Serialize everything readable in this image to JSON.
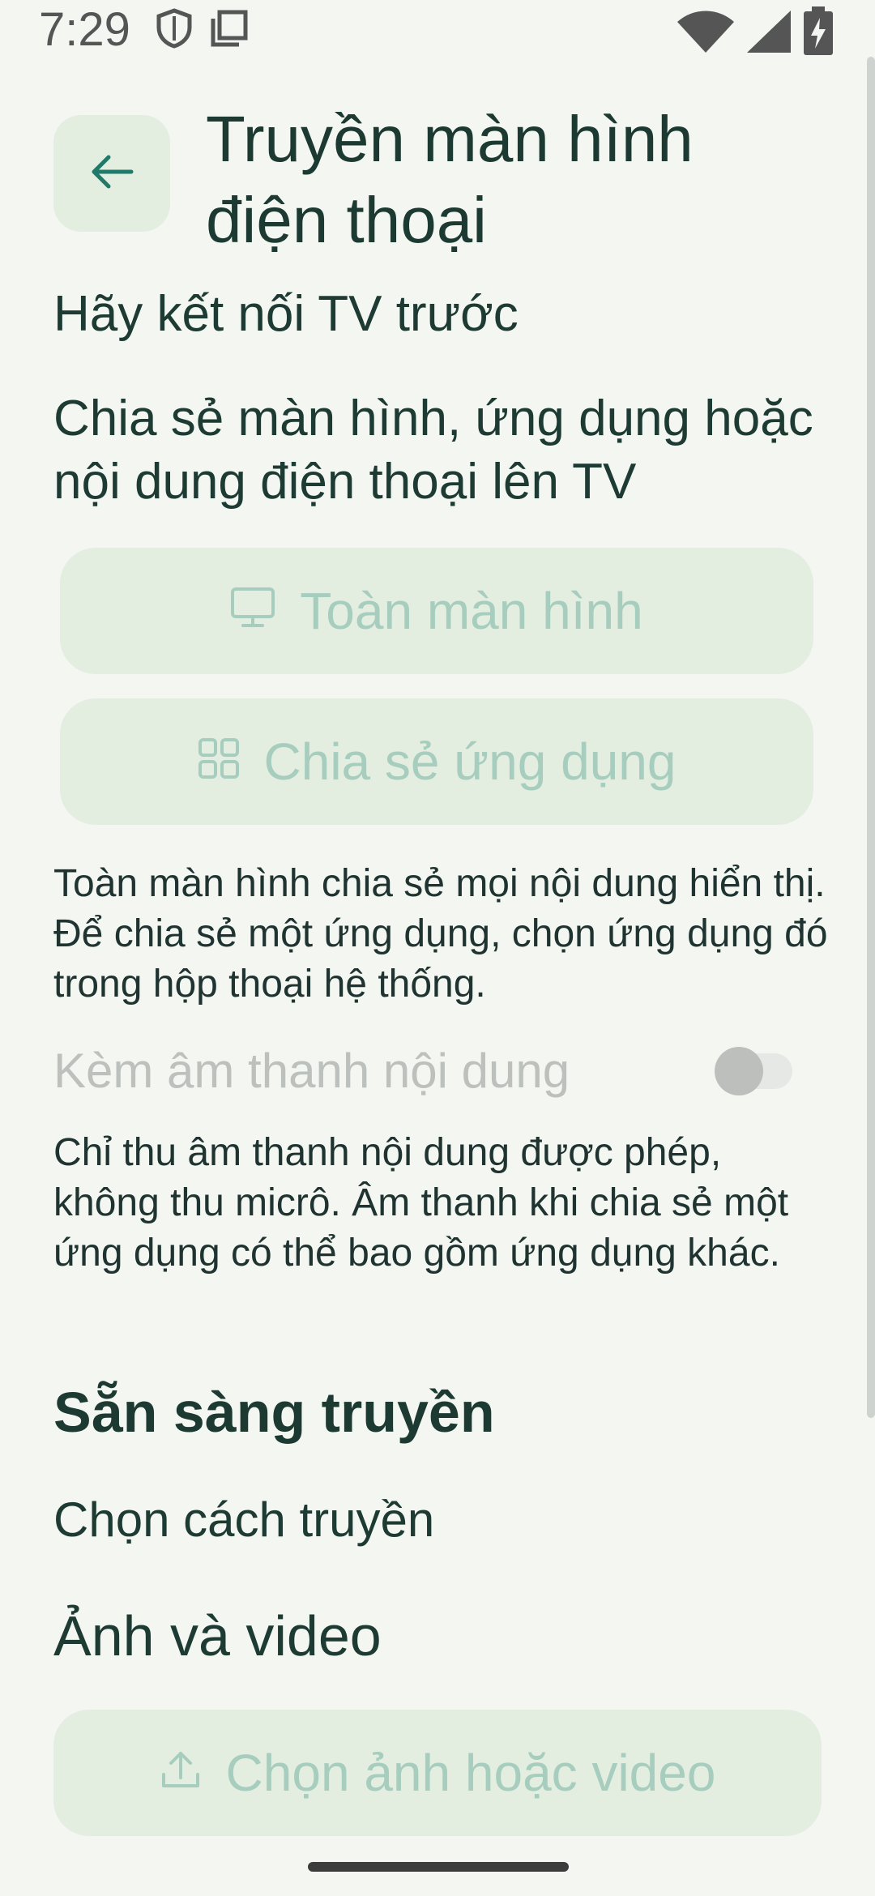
{
  "status_bar": {
    "time": "7:29",
    "icons": [
      "shield-icon",
      "screenshot-icon",
      "wifi-icon",
      "cellular-signal-icon",
      "battery-charging-icon"
    ]
  },
  "header": {
    "back_icon": "arrow-left-icon",
    "title": "Truyền màn hình điện thoại"
  },
  "connect_hint": "Hãy kết nối TV trước",
  "share_description": "Chia sẻ màn hình, ứng dụng hoặc nội dung điện thoại lên TV",
  "buttons": {
    "full_screen": {
      "label": "Toàn màn hình",
      "icon": "monitor-icon",
      "enabled": false
    },
    "share_app": {
      "label": "Chia sẻ ứng dụng",
      "icon": "grid-icon",
      "enabled": false
    }
  },
  "full_screen_note": "Toàn màn hình chia sẻ mọi nội dung hiển thị. Để chia sẻ một ứng dụng, chọn ứng dụng đó trong hộp thoại hệ thống.",
  "audio": {
    "label": "Kèm âm thanh nội dung",
    "enabled": false,
    "checked": false
  },
  "audio_note": "Chỉ thu âm thanh nội dung được phép, không thu micrô. Âm thanh khi chia sẻ một ứng dụng có thể bao gồm ứng dụng khác.",
  "ready_section": {
    "heading": "Sẵn sàng truyền",
    "subheading": "Chọn cách truyền",
    "media_title": "Ảnh và video",
    "media_button": {
      "label": "Chọn ảnh hoặc video",
      "icon": "upload-icon",
      "enabled": false
    }
  },
  "colors": {
    "background": "#f3f6f1",
    "primary_text": "#1c3a31",
    "accent": "#1f7a6a",
    "disabled_button_bg": "#e3eee1",
    "disabled_button_text": "#a6cdbd"
  }
}
